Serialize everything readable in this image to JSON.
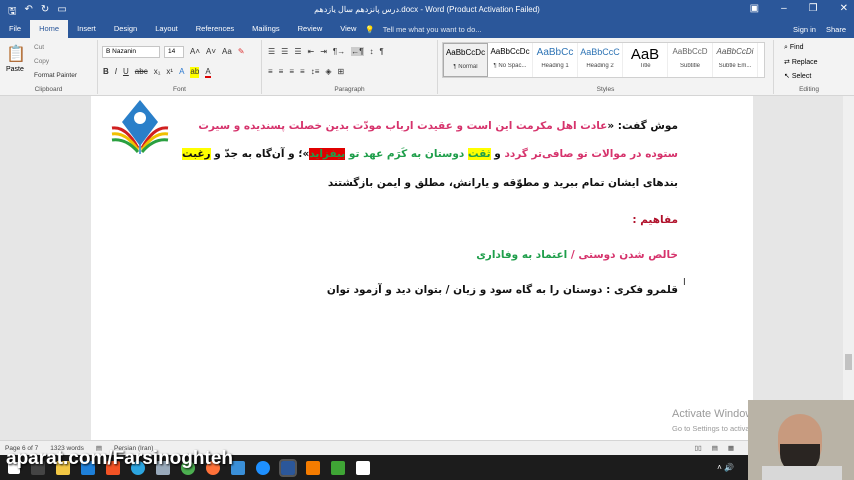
{
  "window": {
    "title": "درس پانزدهم سال یازدهم.docx - Word (Product Activation Failed)"
  },
  "tabs": [
    {
      "label": "File"
    },
    {
      "label": "Home",
      "active": true
    },
    {
      "label": "Insert"
    },
    {
      "label": "Design"
    },
    {
      "label": "Layout"
    },
    {
      "label": "References"
    },
    {
      "label": "Mailings"
    },
    {
      "label": "Review"
    },
    {
      "label": "View"
    }
  ],
  "tell_me": "Tell me what you want to do...",
  "sign_in": "Sign in",
  "share": "Share",
  "clipboard": {
    "paste": "Paste",
    "cut": "Cut",
    "copy": "Copy",
    "format_painter": "Format Painter",
    "label": "Clipboard"
  },
  "font": {
    "name": "B Nazanin",
    "size": "14",
    "label": "Font"
  },
  "paragraph": {
    "label": "Paragraph"
  },
  "styles": {
    "label": "Styles",
    "items": [
      {
        "sample": "AaBbCcDc",
        "name": "¶ Normal"
      },
      {
        "sample": "AaBbCcDc",
        "name": "¶ No Spac..."
      },
      {
        "sample": "AaBbCc",
        "name": "Heading 1"
      },
      {
        "sample": "AaBbCcC",
        "name": "Heading 2"
      },
      {
        "sample": "AaB",
        "name": "Title"
      },
      {
        "sample": "AaBbCcD",
        "name": "Subtitle"
      },
      {
        "sample": "AaBbCcDi",
        "name": "Subtle Em..."
      }
    ]
  },
  "editing": {
    "find": "Find",
    "replace": "Replace",
    "select": "Select",
    "label": "Editing"
  },
  "document": {
    "line1": {
      "a": "موش گفت: «",
      "b": "عادت اهل مکرمت این است و عقیدت ارباب مودّت بدین خصلت پسندیده و سیرت"
    },
    "line2": {
      "a": "ستوده در موالات تو صافی‌تر گردد",
      "b": " و ",
      "c": "ثقت",
      "d": " دوستان به کَرَم عهد تو ",
      "e": "بیفزاید",
      "f": "»؛ و آن‌گاه به جدّ و ",
      "g": "رغبت"
    },
    "line3": "بندهای ایشان تمام ببرید و مطوّقه و یارانش، مطلق و ایمن بازگشتند",
    "heading": "مفاهیم :",
    "concepts": {
      "a": "خالص شدن دوستی",
      "sep": " / ",
      "b": "اعتماد به وفاداری"
    },
    "line4": "قلمرو فکری : دوستان را به گاه سود و زیان / بتوان دید و آزمود توان"
  },
  "activation": {
    "title": "Activate Windows",
    "subtitle": "Go to Settings to activate Windows."
  },
  "status": {
    "page": "Page 6 of 7",
    "words": "1323 words",
    "language": "Persian (Iran)"
  },
  "watermark": "aparat.com/Farsinoghteh",
  "colors": {
    "word_blue": "#2b579a",
    "crimson": "#d6336c",
    "green": "#1e9e4a",
    "highlight_yellow": "#ffff00",
    "highlight_red": "#e00000"
  }
}
